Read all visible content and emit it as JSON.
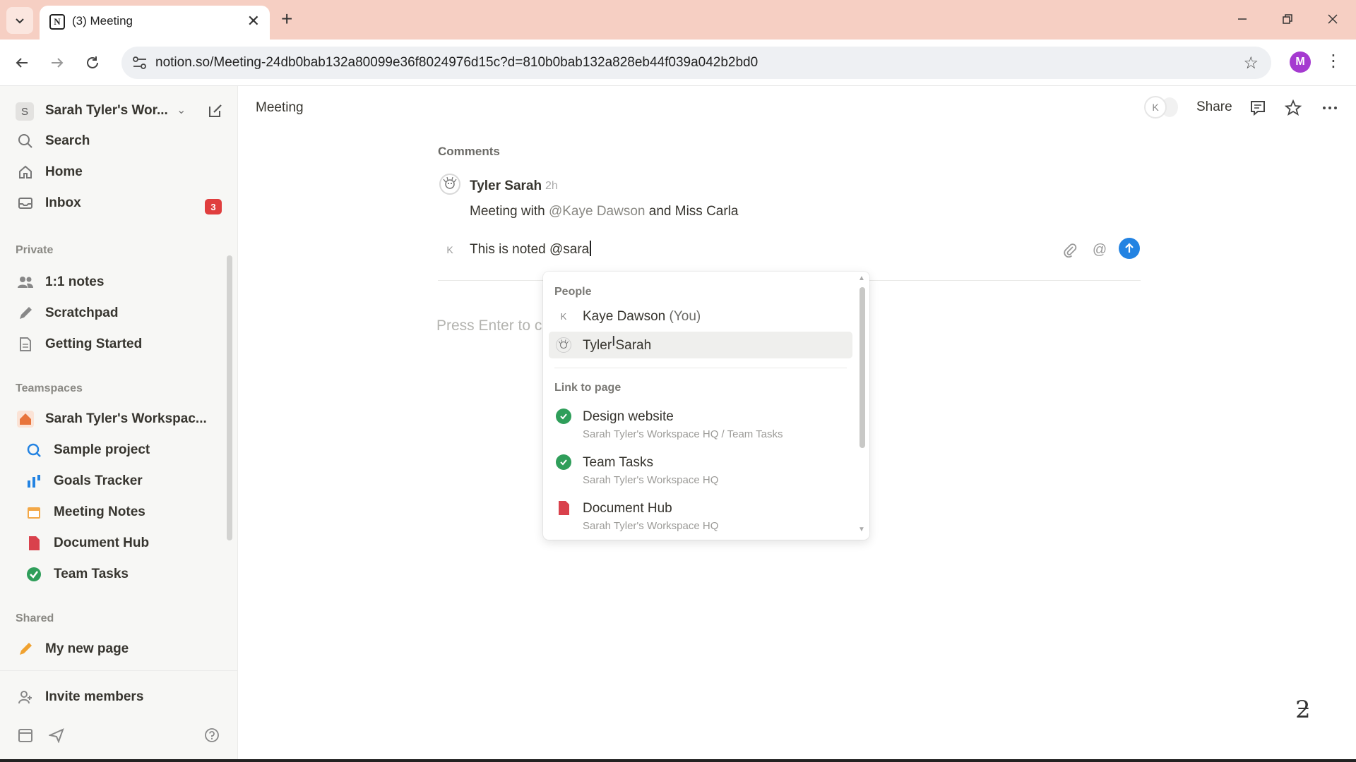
{
  "browser": {
    "tab_title": "(3) Meeting",
    "url": "notion.so/Meeting-24db0bab132a80099e36f8024976d15c?d=810b0bab132a828eb44f039a042b2bd0",
    "profile_initial": "M"
  },
  "sidebar": {
    "workspace_initial": "S",
    "workspace_name": "Sarah Tyler's Wor...",
    "top_items": [
      {
        "label": "Search"
      },
      {
        "label": "Home"
      },
      {
        "label": "Inbox"
      }
    ],
    "inbox_count": "3",
    "private_heading": "Private",
    "private_items": [
      {
        "label": "1:1 notes"
      },
      {
        "label": "Scratchpad"
      },
      {
        "label": "Getting Started"
      }
    ],
    "teamspaces_heading": "Teamspaces",
    "teamspace_name": "Sarah Tyler's Workspac...",
    "teamspace_items": [
      {
        "label": "Sample project"
      },
      {
        "label": "Goals Tracker"
      },
      {
        "label": "Meeting Notes"
      },
      {
        "label": "Document Hub"
      },
      {
        "label": "Team Tasks"
      }
    ],
    "shared_heading": "Shared",
    "shared_items": [
      {
        "label": "My new page"
      }
    ],
    "invite_label": "Invite members"
  },
  "topbar": {
    "page_title": "Meeting",
    "presence_initial": "K",
    "share_label": "Share"
  },
  "comments": {
    "heading": "Comments",
    "author": "Tyler Sarah",
    "time": "2h",
    "body_prefix": "Meeting with ",
    "body_mention": "@Kaye Dawson",
    "body_suffix": " and Miss Carla",
    "reply_avatar": "K",
    "reply_text": "This is noted @sara",
    "placeholder": "Press Enter to c"
  },
  "mention_menu": {
    "people_heading": "People",
    "people": [
      {
        "initial": "K",
        "label": "Kaye Dawson",
        "suffix": " (You)"
      },
      {
        "label": "Tyler Sarah",
        "selected": true
      }
    ],
    "pages_heading": "Link to page",
    "pages": [
      {
        "label": "Design website",
        "path": "Sarah Tyler's Workspace HQ / Team Tasks",
        "icon": "check-circle-icon"
      },
      {
        "label": "Team Tasks",
        "path": "Sarah Tyler's Workspace HQ",
        "icon": "check-circle-icon"
      },
      {
        "label": "Document Hub",
        "path": "Sarah Tyler's Workspace HQ",
        "icon": "document-icon"
      }
    ]
  },
  "colors": {
    "accent": "#2383e2",
    "inbox_badge": "#e03e3e",
    "tabbar": "#f6cfc3",
    "check_green": "#2f9e5a"
  }
}
